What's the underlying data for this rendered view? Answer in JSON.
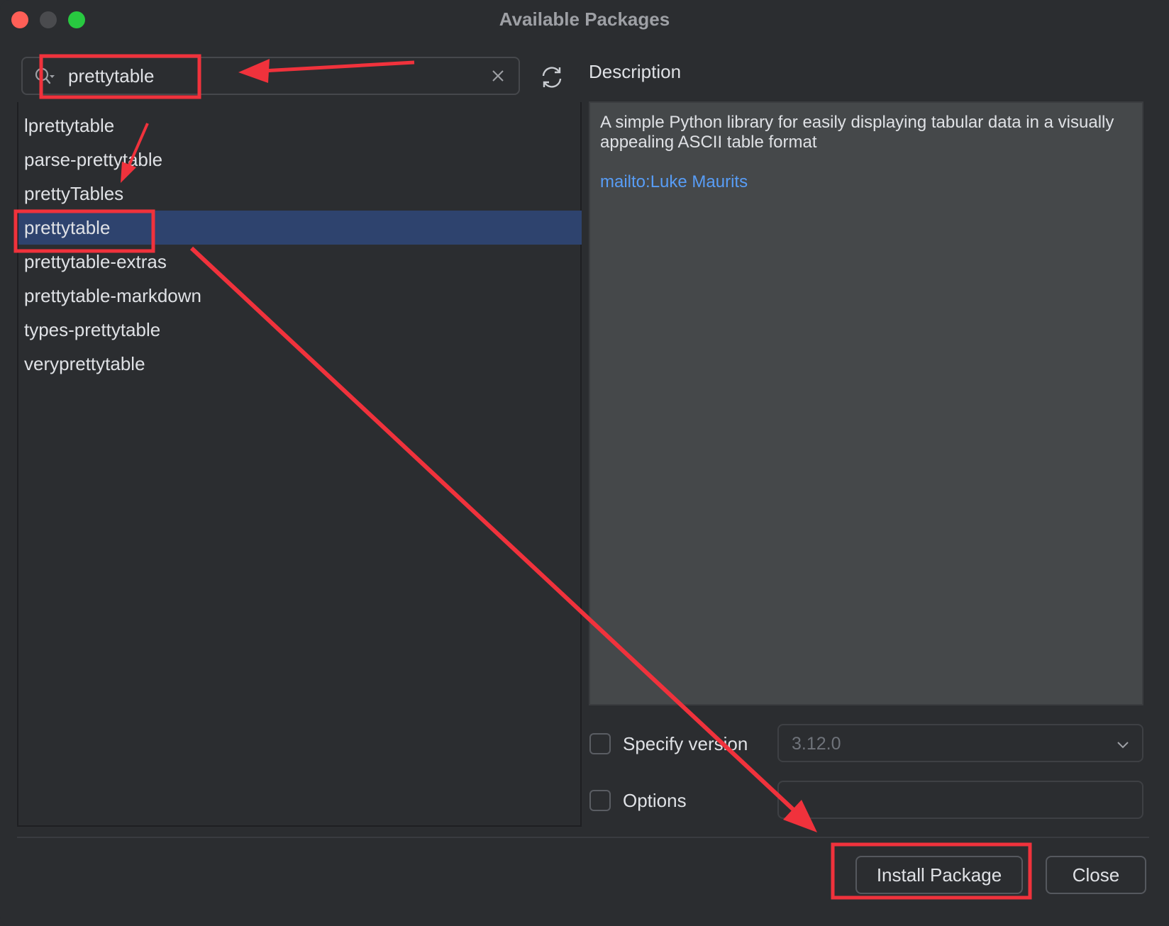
{
  "window": {
    "title": "Available Packages"
  },
  "search": {
    "value": "prettytable"
  },
  "packages": [
    "lprettytable",
    "parse-prettytable",
    "prettyTables",
    "prettytable",
    "prettytable-extras",
    "prettytable-markdown",
    "types-prettytable",
    "veryprettytable"
  ],
  "selected_package": "prettytable",
  "description": {
    "label": "Description",
    "text": "A simple Python library for easily displaying tabular data in a visually appealing ASCII table format",
    "link": "mailto:Luke Maurits"
  },
  "specify_version": {
    "label": "Specify version",
    "checked": false,
    "value": "3.12.0"
  },
  "options": {
    "label": "Options",
    "checked": false,
    "value": ""
  },
  "buttons": {
    "install": "Install Package",
    "close": "Close"
  },
  "icons": {
    "search": "search-icon",
    "clear": "close-icon",
    "refresh": "refresh-icon",
    "chevron": "chevron-down-icon"
  },
  "colors": {
    "background": "#2b2d30",
    "selection": "#2e436e",
    "description_bg": "#45484a",
    "link": "#589df6",
    "annotation": "#f0323c"
  }
}
